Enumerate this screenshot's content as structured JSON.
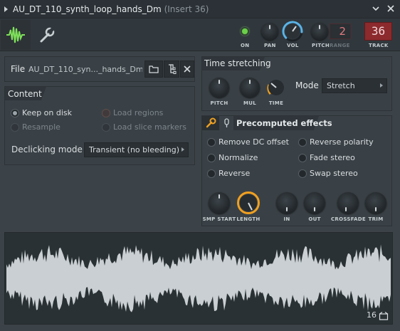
{
  "window": {
    "title": "AU_DT_110_synth_loop_hands_Dm",
    "insert": "(Insert 36)"
  },
  "toolbar": {
    "on_label": "ON",
    "pan_label": "PAN",
    "vol_label": "VOL",
    "pitch_label": "PITCH",
    "range_label": "RANGE",
    "range_value": "2",
    "track_label": "TRACK",
    "track_value": "36",
    "vol_level": 0.85
  },
  "file": {
    "label": "File",
    "value": "AU_DT_110_syn..._hands_Dm.wav"
  },
  "content": {
    "title": "Content",
    "keep_on_disk": "Keep on disk",
    "resample": "Resample",
    "load_regions": "Load regions",
    "load_slice_markers": "Load slice markers",
    "declicking_label": "Declicking mode",
    "declicking_value": "Transient (no bleeding)"
  },
  "time_stretching": {
    "title": "Time stretching",
    "pitch": "PITCH",
    "mul": "MUL",
    "time": "TIME",
    "mode_label": "Mode",
    "mode_value": "Stretch"
  },
  "precomputed": {
    "title": "Precomputed effects",
    "remove_dc": "Remove DC offset",
    "normalize": "Normalize",
    "reverse": "Reverse",
    "reverse_polarity": "Reverse polarity",
    "fade_stereo": "Fade stereo",
    "swap_stereo": "Swap stereo",
    "smp_start": "SMP START",
    "length": "LENGTH",
    "in": "IN",
    "out": "OUT",
    "crossfade": "CROSSFADE",
    "trim": "TRIM"
  },
  "waveform": {
    "zoom_value": "16"
  },
  "colors": {
    "accent_orange": "#f0a020",
    "accent_blue": "#5ab4e8",
    "on_green": "#6cd04a",
    "track_red": "#8c2a2e",
    "waveform": "#c9cfd2"
  }
}
